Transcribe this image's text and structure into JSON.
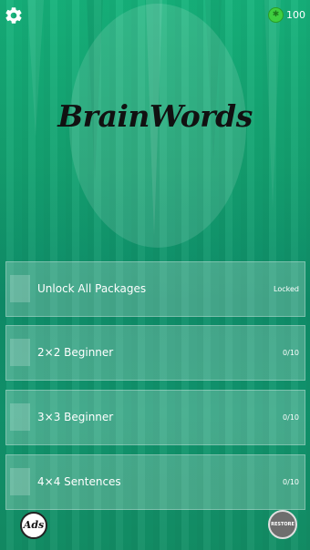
{
  "app": {
    "title": "BrainWords"
  },
  "header": {
    "coin_count": "100",
    "coin_icon": "coin-icon",
    "settings_icon": "gear-icon"
  },
  "packages": [
    {
      "label": "Unlock All Packages",
      "status": "Locked"
    },
    {
      "label": "2×2 Beginner",
      "status": "0/10"
    },
    {
      "label": "3×3 Beginner",
      "status": "0/10"
    },
    {
      "label": "4×4 Sentences",
      "status": "0/10"
    }
  ],
  "footer": {
    "ads_label": "Ads",
    "restore_label": "RESTORE"
  },
  "colors": {
    "background_top": "#16b27b",
    "background_bottom": "#138f66",
    "logo_text": "#111111",
    "restore_button": "#6e6e6e",
    "coin": "#3fcf3f"
  }
}
